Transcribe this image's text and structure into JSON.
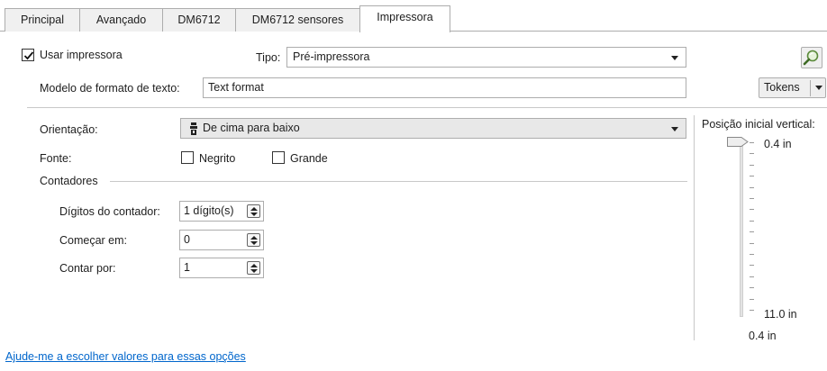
{
  "tabs": [
    {
      "label": "Principal",
      "active": false
    },
    {
      "label": "Avançado",
      "active": false
    },
    {
      "label": "DM6712",
      "active": false
    },
    {
      "label": "DM6712 sensores",
      "active": false
    },
    {
      "label": "Impressora",
      "active": true
    }
  ],
  "printer": {
    "use_label": "Usar impressora",
    "use_checked": true,
    "type_label": "Tipo:",
    "type_value": "Pré-impressora",
    "format_label": "Modelo de formato de texto:",
    "format_value": "Text format",
    "tokens_label": "Tokens",
    "search_icon": "magnifier-icon"
  },
  "orientation": {
    "label": "Orientação:",
    "value": "De cima para baixo",
    "icon": "print-direction-icon"
  },
  "font": {
    "label": "Fonte:",
    "bold_label": "Negrito",
    "bold_checked": false,
    "large_label": "Grande",
    "large_checked": false
  },
  "counters": {
    "group_label": "Contadores",
    "digits_label": "Dígitos do contador:",
    "digits_value": "1 dígito(s)",
    "start_label": "Começar em:",
    "start_value": "0",
    "step_label": "Contar por:",
    "step_value": "1"
  },
  "vertical": {
    "label": "Posição inicial vertical:",
    "top_value": "0.4 in",
    "bottom_value": "11.0 in",
    "current_value": "0.4 in",
    "position_fraction": 0
  },
  "help": {
    "link": "Ajude-me a escolher valores para essas opções"
  },
  "colors": {
    "link": "#0066cc",
    "border": "#adadad"
  }
}
